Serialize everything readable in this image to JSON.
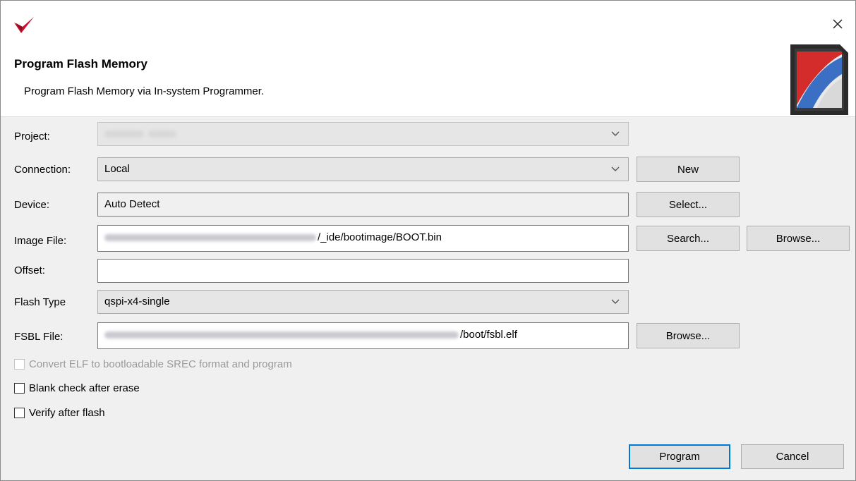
{
  "dialog": {
    "title": "Program Flash Memory",
    "subtitle": "Program Flash Memory via In-system Programmer.",
    "close_symbol": "×"
  },
  "icons": {
    "app_logo": "vitis-logo-icon",
    "banner": "flash-memory-icon",
    "close": "close-icon",
    "dropdown": "chevron-down-icon"
  },
  "colors": {
    "accent": "#0078d7",
    "logo_red": "#c8102e",
    "header_bg": "#ffffff",
    "body_bg": "#f0f0f0"
  },
  "form": {
    "project": {
      "label": "Project:"
    },
    "connection": {
      "label": "Connection:",
      "value": "Local",
      "new_label": "New"
    },
    "device": {
      "label": "Device:",
      "value": "Auto Detect",
      "select_label": "Select..."
    },
    "image_file": {
      "label": "Image File:",
      "value_suffix": "/_ide/bootimage/BOOT.bin",
      "search_label": "Search...",
      "browse_label": "Browse..."
    },
    "offset": {
      "label": "Offset:",
      "value": ""
    },
    "flash_type": {
      "label": "Flash Type",
      "value": "qspi-x4-single"
    },
    "fsbl_file": {
      "label": "FSBL File:",
      "value_suffix": "/boot/fsbl.elf",
      "browse_label": "Browse..."
    }
  },
  "options": {
    "convert_elf": {
      "label": "Convert ELF to bootloadable SREC format and program",
      "checked": false,
      "enabled": false
    },
    "blank_check": {
      "label": "Blank check after erase",
      "checked": false
    },
    "verify": {
      "label": "Verify after flash",
      "checked": false
    }
  },
  "footer": {
    "program_label": "Program",
    "cancel_label": "Cancel"
  }
}
